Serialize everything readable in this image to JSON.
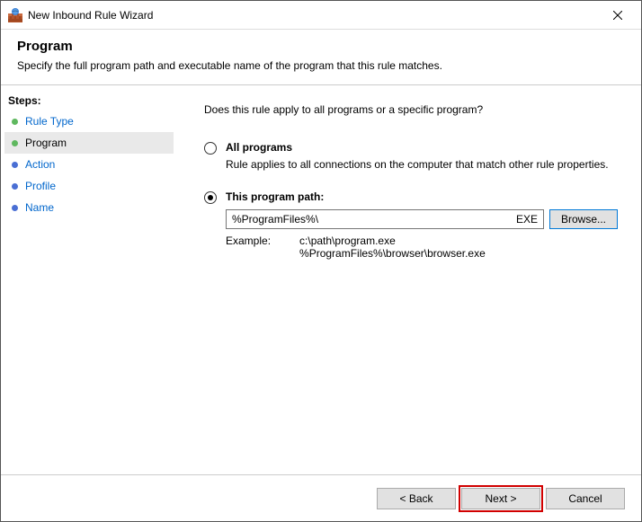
{
  "window": {
    "title": "New Inbound Rule Wizard"
  },
  "header": {
    "title": "Program",
    "description": "Specify the full program path and executable name of the program that this rule matches."
  },
  "steps": {
    "heading": "Steps:",
    "items": [
      {
        "label": "Rule Type"
      },
      {
        "label": "Program"
      },
      {
        "label": "Action"
      },
      {
        "label": "Profile"
      },
      {
        "label": "Name"
      }
    ]
  },
  "content": {
    "question": "Does this rule apply to all programs or a specific program?",
    "option_all": {
      "label": "All programs",
      "sub": "Rule applies to all connections on the computer that match other rule properties."
    },
    "option_path": {
      "label": "This program path:",
      "value": "%ProgramFiles%\\",
      "ext": "EXE",
      "browse": "Browse...",
      "example_label": "Example:",
      "example1": "c:\\path\\program.exe",
      "example2": "%ProgramFiles%\\browser\\browser.exe"
    }
  },
  "footer": {
    "back": "< Back",
    "next": "Next >",
    "cancel": "Cancel"
  }
}
